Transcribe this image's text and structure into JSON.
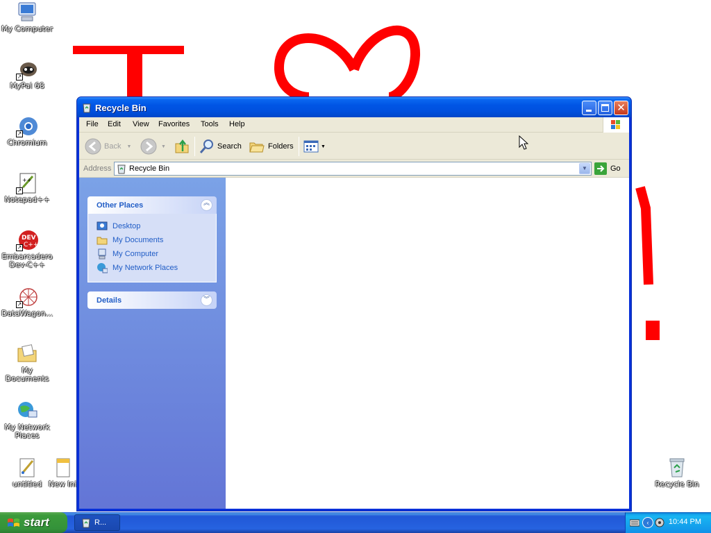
{
  "desktop": {
    "icons": [
      {
        "label": "My Computer"
      },
      {
        "label": "MyPal 68"
      },
      {
        "label": "Chromium"
      },
      {
        "label": "Notepad++"
      },
      {
        "label": "Embarcadero Dev-C++"
      },
      {
        "label": "DataWagon..."
      },
      {
        "label": "My Documents"
      },
      {
        "label": "My Network Places"
      },
      {
        "label": "untitled"
      },
      {
        "label": "New Ini"
      },
      {
        "label": "Recycle Bin"
      }
    ],
    "wallpaper_color": "#ffffff",
    "drawing_color": "#ff0000"
  },
  "window": {
    "title": "Recycle Bin",
    "menu": [
      "File",
      "Edit",
      "View",
      "Favorites",
      "Tools",
      "Help"
    ],
    "toolbar": {
      "back": "Back",
      "search": "Search",
      "folders": "Folders"
    },
    "address": {
      "label": "Address",
      "value": "Recycle Bin",
      "go": "Go"
    },
    "other_places": {
      "title": "Other Places",
      "items": [
        "Desktop",
        "My Documents",
        "My Computer",
        "My Network Places"
      ]
    },
    "details": {
      "title": "Details"
    }
  },
  "taskbar": {
    "start": "start",
    "task_label": "R...",
    "clock": "10:44 PM"
  }
}
